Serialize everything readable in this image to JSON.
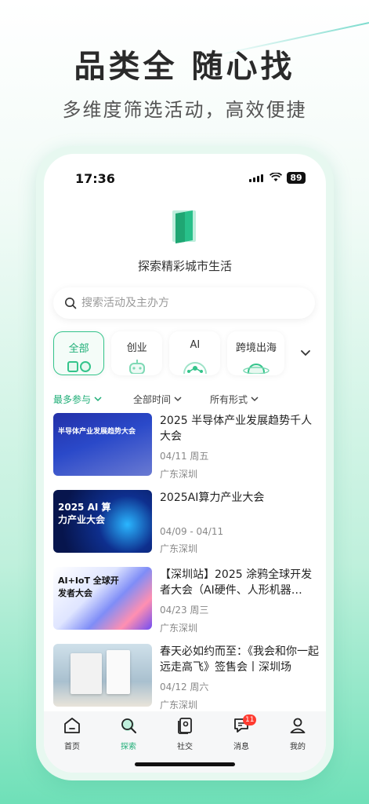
{
  "promo": {
    "headline": "品类全 随心找",
    "subline": "多维度筛选活动，高效便捷"
  },
  "status": {
    "time": "17:36",
    "battery": "89"
  },
  "app": {
    "tagline": "探索精彩城市生活"
  },
  "search": {
    "placeholder": "搜索活动及主办方"
  },
  "categories": [
    {
      "label": "全部",
      "active": true
    },
    {
      "label": "创业"
    },
    {
      "label": "AI"
    },
    {
      "label": "跨境出海"
    }
  ],
  "filters": [
    "最多参与",
    "全部时间",
    "所有形式"
  ],
  "events": [
    {
      "title": "2025 半导体产业发展趋势千人大会",
      "date": "04/11 周五",
      "location": "广东深圳",
      "thumb_text": "半导体产业发展趋势大会"
    },
    {
      "title": "2025AI算力产业大会",
      "date": "04/09 - 04/11",
      "location": "广东深圳",
      "thumb_text": "2025 AI 算力产业大会"
    },
    {
      "title": "【深圳站】2025 涂鸦全球开发者大会（AI硬件、人形机器人、…",
      "date": "04/23 周三",
      "location": "广东深圳",
      "thumb_text": "AI+IoT 全球开发者大会"
    },
    {
      "title": "春天必如约而至：《我会和你一起远走高飞》签售会丨深圳场",
      "date": "04/12 周六",
      "location": "广东深圳",
      "thumb_text": ""
    }
  ],
  "tabs": [
    {
      "label": "首页",
      "icon": "home-icon"
    },
    {
      "label": "探索",
      "icon": "search-icon",
      "active": true
    },
    {
      "label": "社交",
      "icon": "cards-icon"
    },
    {
      "label": "消息",
      "icon": "message-icon",
      "badge": "11"
    },
    {
      "label": "我的",
      "icon": "user-icon"
    }
  ],
  "colors": {
    "accent": "#1fae77",
    "badge": "#ff3b30"
  }
}
